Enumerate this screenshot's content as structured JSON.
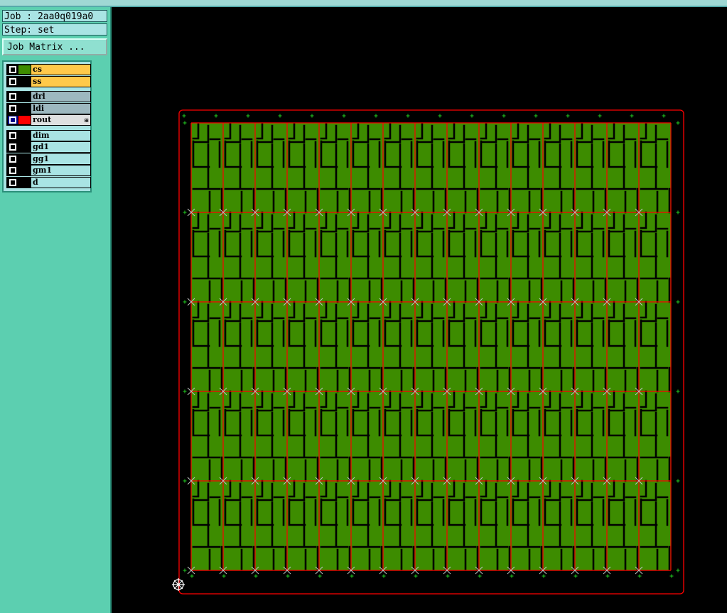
{
  "header": {
    "job_label": "Job : 2aa0q019a0",
    "step_label": "Step: set"
  },
  "toolbar": {
    "job_matrix_label": "Job Matrix ..."
  },
  "layers": [
    {
      "name": "cs",
      "swatch": "#3d8c00",
      "row_color": "#ffc94a",
      "group": 1,
      "active": false
    },
    {
      "name": "ss",
      "swatch": "#000000",
      "row_color": "#ffc94a",
      "group": 1,
      "active": false
    },
    {
      "name": "drl",
      "swatch": "#000000",
      "row_color": "#9db8bf",
      "group": 2,
      "active": false
    },
    {
      "name": "ldi",
      "swatch": "#000000",
      "row_color": "#9db8bf",
      "group": 2,
      "active": false
    },
    {
      "name": "rout",
      "swatch": "#ff0000",
      "row_color": "#dfe0e0",
      "group": 2,
      "active": true
    },
    {
      "name": "dim",
      "swatch": "#000000",
      "row_color": "#a9e4e4",
      "group": 3,
      "active": false
    },
    {
      "name": "gd1",
      "swatch": "#000000",
      "row_color": "#a9e4e4",
      "group": 3,
      "active": false
    },
    {
      "name": "gg1",
      "swatch": "#000000",
      "row_color": "#a9e4e4",
      "group": 3,
      "active": false
    },
    {
      "name": "gm1",
      "swatch": "#000000",
      "row_color": "#a9e4e4",
      "group": 3,
      "active": false
    },
    {
      "name": "d",
      "swatch": "#000000",
      "row_color": "#a9e4e4",
      "group": 3,
      "active": false
    }
  ],
  "panel": {
    "columns": 15,
    "rows": 5
  },
  "colors": {
    "board_fill": "#3d8c00",
    "rout_line": "#ff0000",
    "trace": "#000000",
    "fiducial": "#22cc22",
    "cross": "#c0c0c0",
    "sidebar": "#5ccfb0"
  },
  "icons": {
    "origin": "crosshair-origin-icon",
    "checkbox": "checkbox-icon"
  }
}
